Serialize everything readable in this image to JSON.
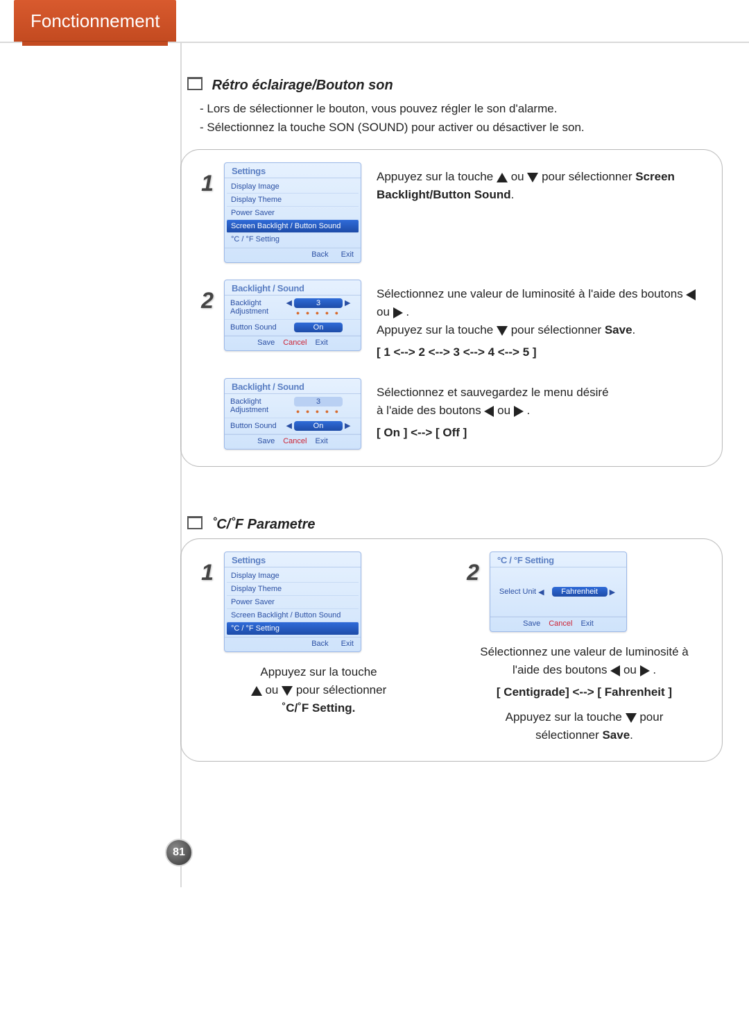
{
  "header": {
    "title": "Fonctionnement"
  },
  "pageNumber": "81",
  "sectionA": {
    "title": "Rétro éclairage/Bouton son",
    "intro1": "- Lors de sélectionner le bouton, vous pouvez régler le son d'alarme.",
    "intro2": "- Sélectionnez la touche SON (SOUND) pour activer ou désactiver le son.",
    "step1": {
      "num": "1",
      "screenTitle": "Settings",
      "menu": [
        "Display Image",
        "Display Theme",
        "Power Saver",
        "Screen Backlight / Button Sound",
        "°C / °F Setting"
      ],
      "selectedIndex": 3,
      "back": "Back",
      "exit": "Exit",
      "descA": "Appuyez sur la touche ",
      "descB": " ou ",
      "descC": " pour sélectionner ",
      "bold": "Screen Backlight/Button Sound",
      "descD": "."
    },
    "step2": {
      "num": "2",
      "screenTitle": "Backlight / Sound",
      "adjLabel": "Backlight Adjustment",
      "adjValue": "3",
      "soundLabel": "Button Sound",
      "soundValue": "On",
      "save": "Save",
      "cancel": "Cancel",
      "exit": "Exit",
      "line1a": "Sélectionnez une valeur de luminosité à l'aide des boutons ",
      "line1b": " ou ",
      "line1c": ".",
      "line2a": "Appuyez sur la touche ",
      "line2b": " pour sélectionner ",
      "line2bold": "Save",
      "line2c": ".",
      "sequence": "[ 1 <--> 2 <--> 3 <--> 4 <--> 5 ]"
    },
    "step3": {
      "screenTitle": "Backlight / Sound",
      "adjLabel": "Backlight Adjustment",
      "adjValue": "3",
      "soundLabel": "Button Sound",
      "soundValue": "On",
      "save": "Save",
      "cancel": "Cancel",
      "exit": "Exit",
      "line1": "Sélectionnez et sauvegardez le menu désiré",
      "line2a": "à l'aide des boutons ",
      "line2b": " ou ",
      "line2c": ".",
      "toggle": "[ On ] <--> [ Off ]"
    }
  },
  "sectionB": {
    "title": "˚C/˚F Parametre",
    "col1": {
      "num": "1",
      "screenTitle": "Settings",
      "menu": [
        "Display Image",
        "Display Theme",
        "Power Saver",
        "Screen Backlight / Button Sound",
        "°C / °F Setting"
      ],
      "selectedIndex": 4,
      "back": "Back",
      "exit": "Exit",
      "line1": "Appuyez sur la touche",
      "line2a": " ou ",
      "line2b": " pour sélectionner",
      "bold": "˚C/˚F Setting."
    },
    "col2": {
      "num": "2",
      "screenTitle": "°C / °F Setting",
      "selectLabel": "Select Unit",
      "selectValue": "Fahrenheit",
      "save": "Save",
      "cancel": "Cancel",
      "exit": "Exit",
      "line1": "Sélectionnez une valeur de luminosité à",
      "line2a": "l'aide des boutons ",
      "line2b": " ou ",
      "line2c": ".",
      "toggle": "[ Centigrade] <--> [ Fahrenheit ]",
      "line3a": "Appuyez sur la touche ",
      "line3b": " pour",
      "line4a": "sélectionner ",
      "line4bold": "Save",
      "line4b": "."
    }
  }
}
